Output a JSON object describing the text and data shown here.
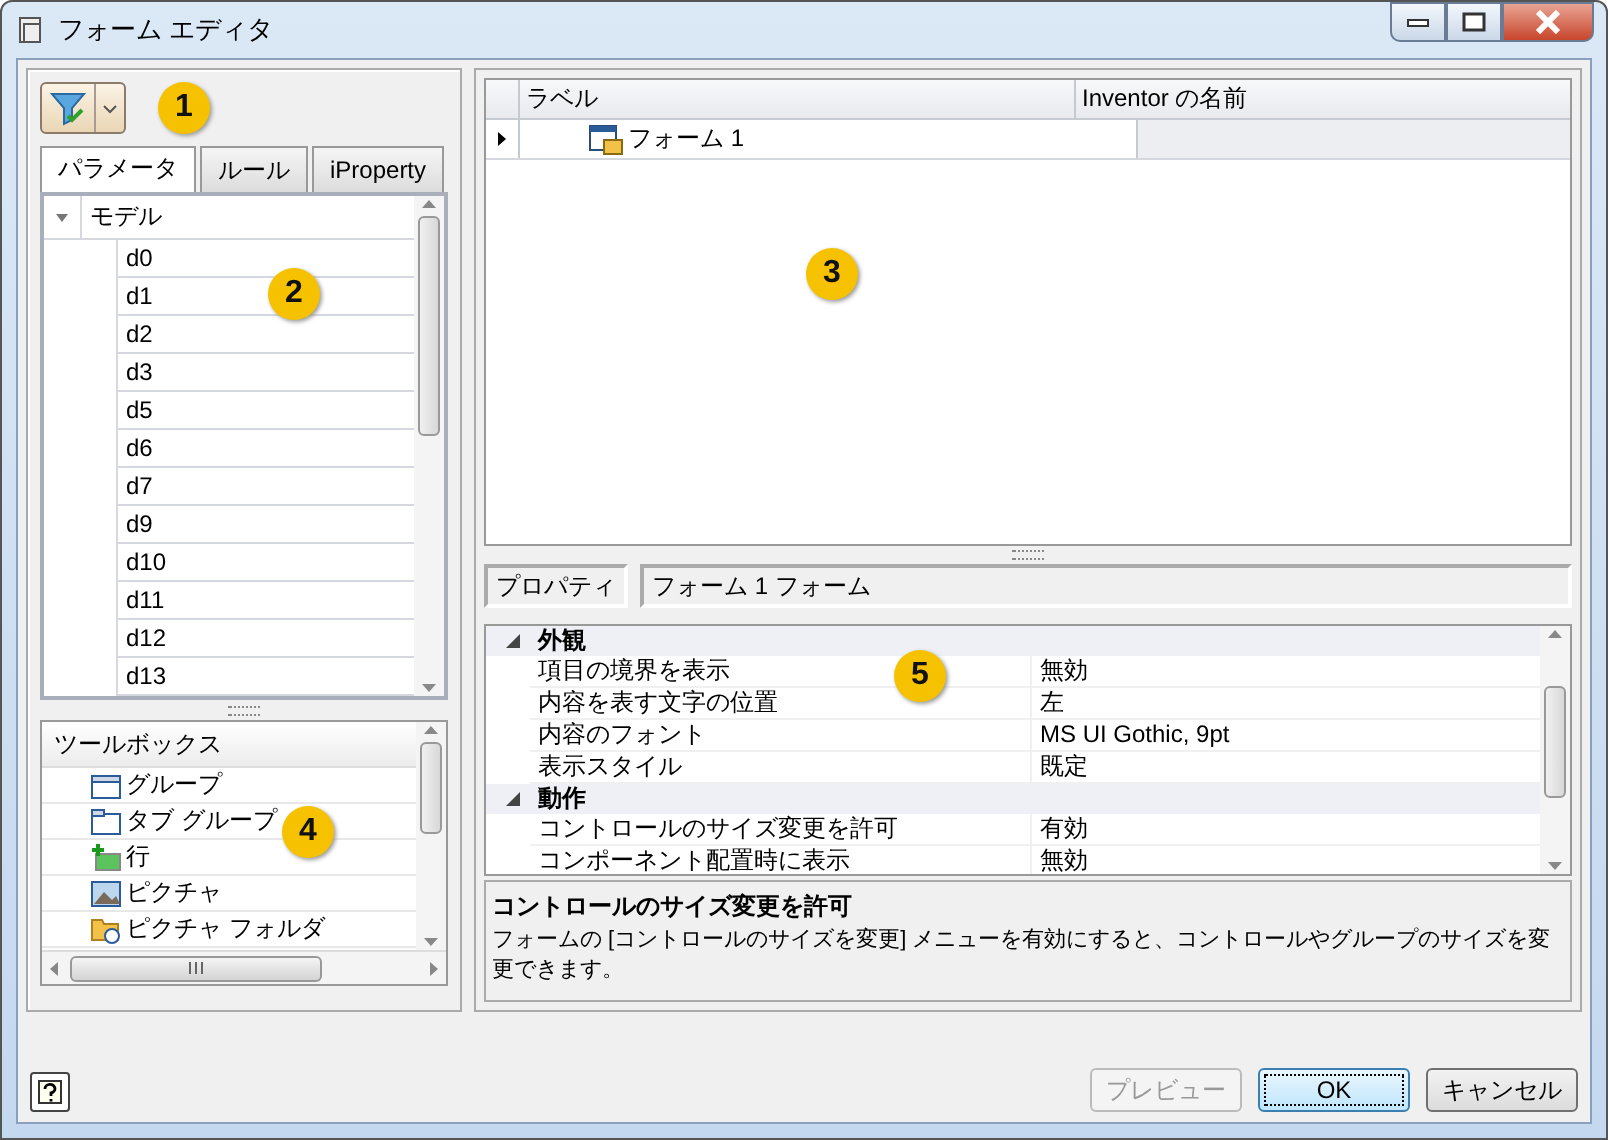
{
  "window": {
    "title": "フォーム エディタ"
  },
  "callouts": [
    "1",
    "2",
    "3",
    "4",
    "5"
  ],
  "tabs": [
    {
      "label": "パラメータ",
      "selected": true
    },
    {
      "label": "ルール",
      "selected": false
    },
    {
      "label": "iProperty",
      "selected": false
    }
  ],
  "parameter_tree": {
    "label": "モデル",
    "expanded": true,
    "children": [
      {
        "label": "d0"
      },
      {
        "label": "d1"
      },
      {
        "label": "d2"
      },
      {
        "label": "d3"
      },
      {
        "label": "d5"
      },
      {
        "label": "d6"
      },
      {
        "label": "d7"
      },
      {
        "label": "d9"
      },
      {
        "label": "d10"
      },
      {
        "label": "d11"
      },
      {
        "label": "d12"
      },
      {
        "label": "d13"
      }
    ]
  },
  "toolbox": {
    "title": "ツールボックス",
    "items": [
      {
        "label": "グループ",
        "kind": "group"
      },
      {
        "label": "タブ グループ",
        "kind": "tab-group"
      },
      {
        "label": "行",
        "kind": "row"
      },
      {
        "label": "ピクチャ",
        "kind": "picture"
      },
      {
        "label": "ピクチャ フォルダ",
        "kind": "picture-folder"
      }
    ]
  },
  "form_grid": {
    "columns": [
      "ラベル",
      "Inventor の名前"
    ],
    "rows": [
      {
        "label": "フォーム 1",
        "current": true
      }
    ]
  },
  "properties": {
    "header_label": "プロパティ",
    "object": "フォーム 1 フォーム",
    "categories": [
      {
        "name": "外観",
        "expanded": true,
        "rows": [
          {
            "name": "項目の境界を表示",
            "value": "無効"
          },
          {
            "name": "内容を表す文字の位置",
            "value": "左"
          },
          {
            "name": "内容のフォント",
            "value": "MS UI Gothic, 9pt"
          },
          {
            "name": "表示スタイル",
            "value": "既定"
          }
        ]
      },
      {
        "name": "動作",
        "expanded": true,
        "rows": [
          {
            "name": "コントロールのサイズ変更を許可",
            "value": "有効"
          },
          {
            "name": "コンポーネント配置時に表示",
            "value": "無効"
          }
        ]
      }
    ],
    "description": {
      "title": "コントロールのサイズ変更を許可",
      "text": "フォームの [コントロールのサイズを変更] メニューを有効にすると、コントロールやグループのサイズを変更できます。"
    }
  },
  "buttons": [
    {
      "label": "プレビュー",
      "disabled": true,
      "default": false
    },
    {
      "label": "OK",
      "disabled": false,
      "default": true
    },
    {
      "label": "キャンセル",
      "disabled": false,
      "default": false
    }
  ]
}
